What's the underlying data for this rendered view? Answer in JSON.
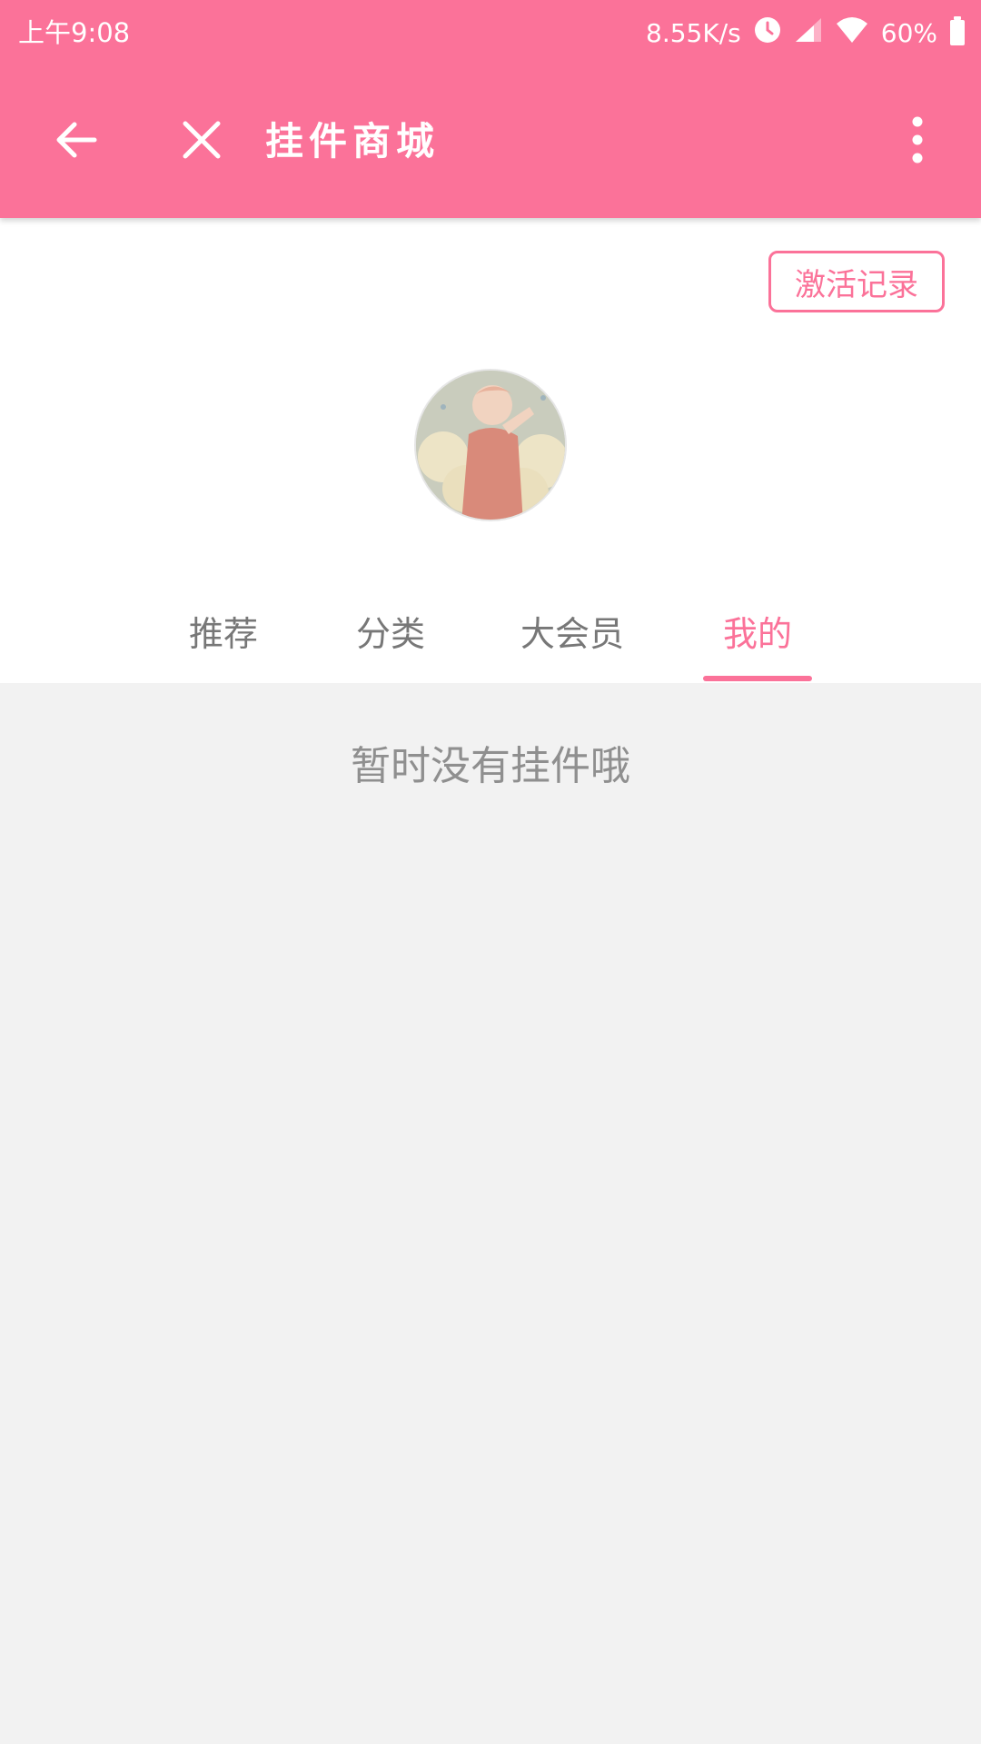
{
  "status_bar": {
    "time": "上午9:08",
    "net_speed": "8.55K/s",
    "battery": "60%"
  },
  "toolbar": {
    "title": "挂件商城",
    "back_icon": "arrow-left-icon",
    "close_icon": "close-icon",
    "more_icon": "more-vertical-icon"
  },
  "header": {
    "activation_record_label": "激活记录"
  },
  "tabs": [
    {
      "label": "推荐",
      "active": false
    },
    {
      "label": "分类",
      "active": false
    },
    {
      "label": "大会员",
      "active": false
    },
    {
      "label": "我的",
      "active": true
    }
  ],
  "empty_state": {
    "message": "暂时没有挂件哦"
  },
  "colors": {
    "accent": "#fb7299",
    "background": "#f2f2f2",
    "muted_text": "#8f8f8f"
  }
}
